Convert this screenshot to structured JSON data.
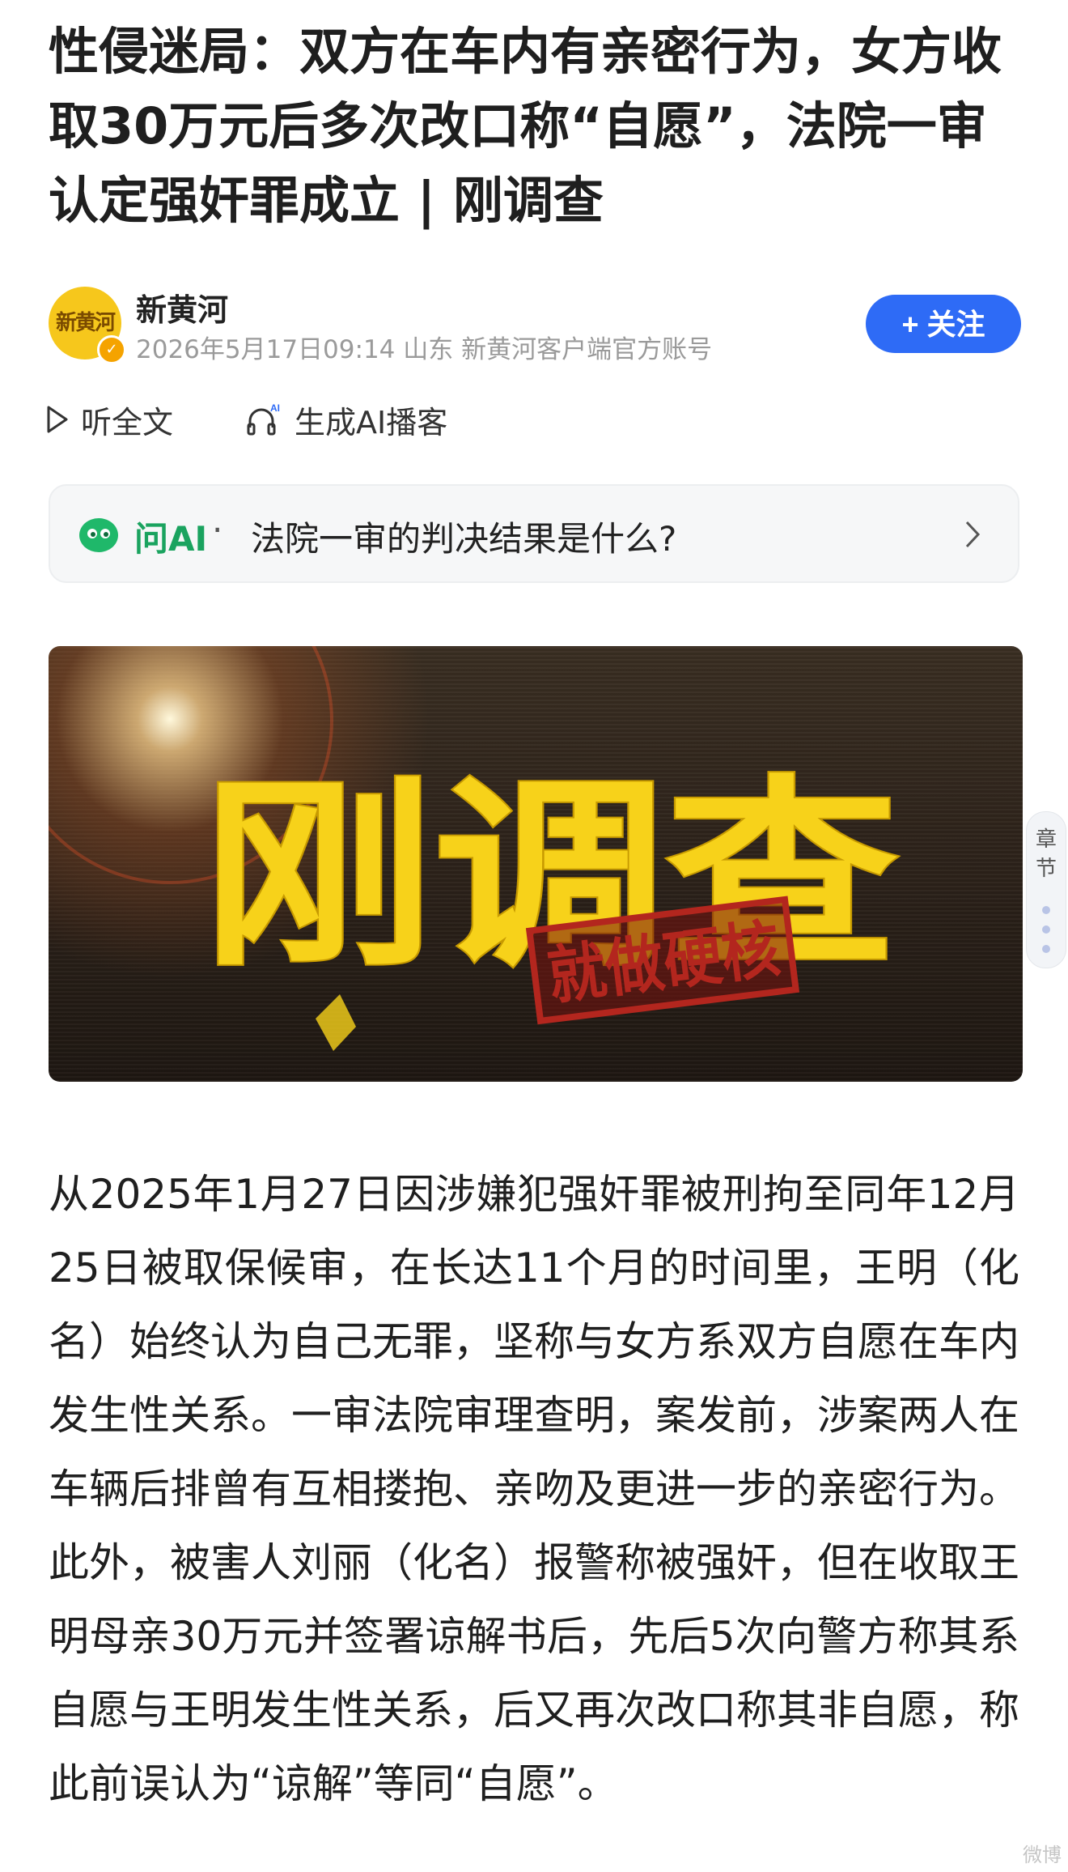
{
  "article": {
    "title": "性侵迷局：双方在车内有亲密行为，女方收取30万元后多次改口称“自愿”，法院一审认定强奸罪成立 | 刚调查"
  },
  "author": {
    "avatar_text": "新黄河",
    "name": "新黄河",
    "meta": "2026年5月17日09:14 山东 新黄河客户端官方账号",
    "follow_label": "+ 关注"
  },
  "actions": {
    "listen_label": "听全文",
    "podcast_label": "生成AI播客",
    "podcast_badge": "AI"
  },
  "ask_ai": {
    "label": "问AI",
    "separator": "·",
    "question": "法院一审的判决结果是什么?"
  },
  "hero": {
    "title": "刚调查",
    "stamp": "就做硬核",
    "colors": {
      "title": "#f7d21a",
      "stamp": "#b3261e"
    }
  },
  "chapter": {
    "label": "章节"
  },
  "body": {
    "paragraph": "从2025年1月27日因涉嫌犯强奸罪被刑拘至同年12月25日被取保候审，在长达11个月的时间里，王明（化名）始终认为自己无罪，坚称与女方系双方自愿在车内发生性关系。一审法院审理查明，案发前，涉案两人在车辆后排曾有互相搂抱、亲吻及更进一步的亲密行为。此外，被害人刘丽（化名）报警称被强奸，但在收取王明母亲30万元并签署谅解书后，先后5次向警方称其系自愿与王明发生性关系，后又再次改口称其非自愿，称此前误认为“谅解”等同“自愿”。"
  },
  "watermark": "微博"
}
